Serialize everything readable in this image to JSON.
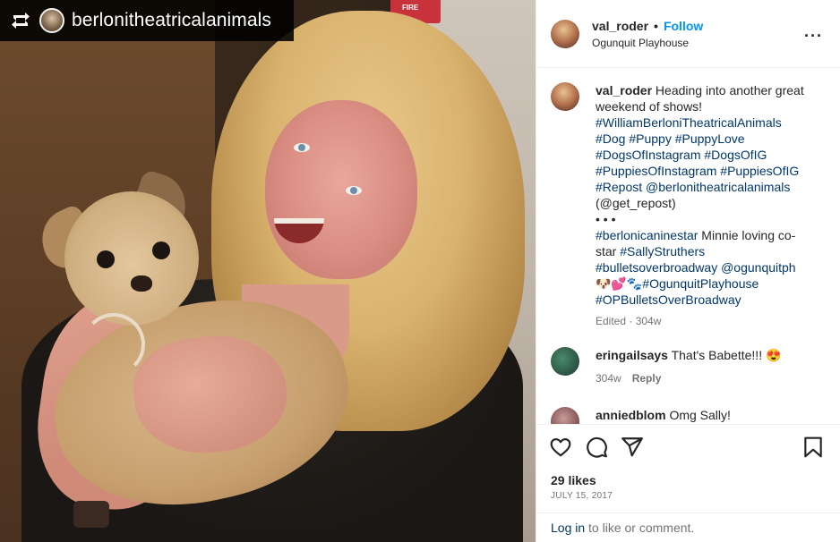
{
  "repost_banner": {
    "username": "berlonitheatricalanimals",
    "icon": "repost-icon"
  },
  "photo": {
    "sign_text": "FIRE"
  },
  "post_header": {
    "username": "val_roder",
    "separator": "•",
    "follow_label": "Follow",
    "location": "Ogunquit Playhouse",
    "more_icon": "more-options-icon",
    "more_label": "···"
  },
  "caption": {
    "username": "val_roder",
    "text_1": " Heading into another great weekend of shows! ",
    "tags_1": [
      "#WilliamBerloniTheatricalAnimals",
      "#Dog",
      "#Puppy",
      "#PuppyLove",
      "#DogsOfInstagram",
      "#DogsOfIG",
      "#PuppiesOfInstagram",
      "#PuppiesOfIG",
      "#Repost",
      "@berlonitheatricalanimals"
    ],
    "repost_credit": "(@get_repost)",
    "dots": "• • •",
    "tag_caninestar": "#berlonicaninestar",
    "text_2": " Minnie loving co-star ",
    "tag_sally": "#SallyStruthers",
    "tag_bullets": "#bulletsoverbroadway",
    "mention_ogunquit": "@ogunquitph",
    "emoji": "🐶💕🐾",
    "tag_playhouse": "#OgunquitPlayhouse",
    "tag_op": "#OPBulletsOverBroadway",
    "meta": "Edited · 304w"
  },
  "comments": [
    {
      "username": "eringailsays",
      "text": " That's Babette!!! 😍",
      "age": "304w",
      "reply_label": "Reply"
    },
    {
      "username": "anniedblom",
      "text": " Omg Sally!"
    }
  ],
  "actions": {
    "like_icon": "heart-icon",
    "comment_icon": "comment-icon",
    "share_icon": "share-icon",
    "save_icon": "bookmark-icon",
    "likes": "29 likes",
    "date": "JULY 15, 2017",
    "login_link": "Log in",
    "login_rest": " to like or comment."
  }
}
